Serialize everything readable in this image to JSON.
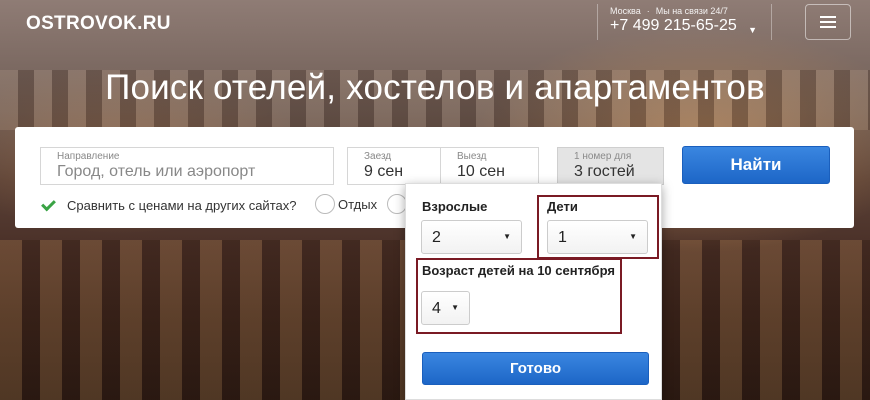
{
  "header": {
    "logo": "OSTROVOK.RU",
    "city": "Москва",
    "support": "Мы на связи 24/7",
    "phone": "+7 499 215-65-25",
    "menu_icon": "hamburger-menu-icon"
  },
  "hero": {
    "title": "Поиск отелей, хостелов и апартаментов"
  },
  "search": {
    "destination": {
      "label": "Направление",
      "placeholder": "Город, отель или аэропорт"
    },
    "checkin": {
      "label": "Заезд",
      "value": "9 сен"
    },
    "checkout": {
      "label": "Выезд",
      "value": "10 сен"
    },
    "guests": {
      "label": "1 номер для",
      "value": "3 гостей"
    },
    "submit_label": "Найти",
    "compare_label": "Сравнить с ценами на других сайтах?",
    "compare_checked": true,
    "trip_types": [
      "Отдых"
    ]
  },
  "guests_dropdown": {
    "adults_label": "Взрослые",
    "adults_value": "2",
    "kids_label": "Дети",
    "kids_value": "1",
    "age_label": "Возраст детей на 10 сентября",
    "age_value": "4",
    "done_label": "Готово"
  },
  "colors": {
    "primary_button": "#1d66c7",
    "check_green": "#3aa345",
    "highlight_border": "#7a1a24"
  }
}
